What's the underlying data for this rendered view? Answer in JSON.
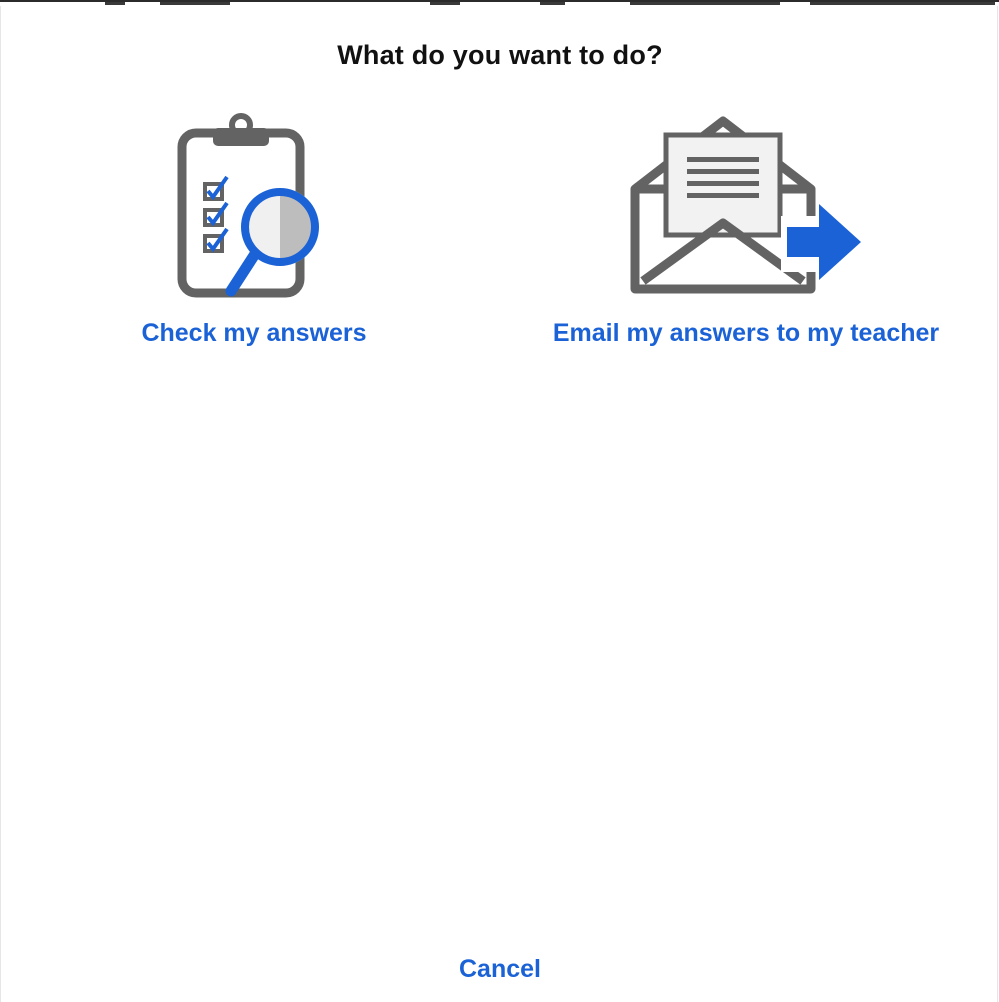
{
  "dialog": {
    "title": "What do you want to do?",
    "options": [
      {
        "label": "Check my answers",
        "icon": "clipboard-magnifier-icon"
      },
      {
        "label": "Email my answers to my teacher",
        "icon": "envelope-send-icon"
      }
    ],
    "cancel_label": "Cancel"
  },
  "colors": {
    "accent": "#1a62d6",
    "icon_gray": "#636363",
    "title_text": "#111111",
    "background": "#ffffff"
  }
}
